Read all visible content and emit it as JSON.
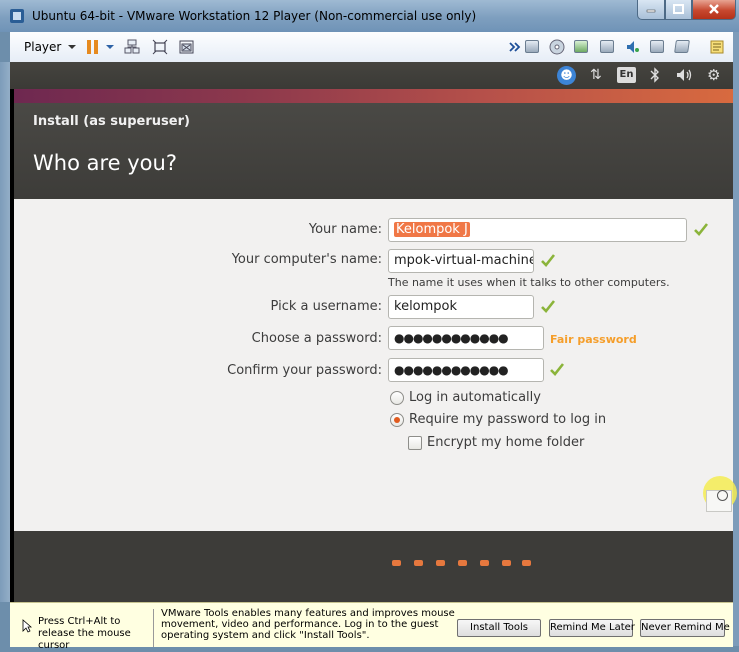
{
  "window": {
    "title": "Ubuntu 64-bit - VMware Workstation 12 Player (Non-commercial use only)"
  },
  "toolbar": {
    "player_label": "Player",
    "icons": [
      "pause-icon",
      "send-ctrl-alt-del-icon",
      "fullscreen-icon",
      "unity-icon",
      "forward-arrows-icon",
      "hard-disk-icon",
      "cd-dvd-icon",
      "network-adapter-icon",
      "printer-icon",
      "sound-card-icon",
      "display-icon",
      "usb-icon",
      "messages-icon"
    ]
  },
  "top_panel": {
    "keyboard_layout": "En",
    "icons": [
      "accessibility-icon",
      "network-icon",
      "bluetooth-icon",
      "volume-icon",
      "settings-gear-icon"
    ]
  },
  "installer": {
    "window_title": "Install (as superuser)",
    "page_title": "Who are you?",
    "fields": {
      "name": {
        "label": "Your name:",
        "value": "Kelompok J"
      },
      "computer_name": {
        "label": "Your computer's name:",
        "value": "mpok-virtual-machine",
        "hint": "The name it uses when it talks to other computers."
      },
      "username": {
        "label": "Pick a username:",
        "value": "kelompok"
      },
      "password": {
        "label": "Choose a password:",
        "value": "●●●●●●●●●●●●",
        "strength": "Fair password"
      },
      "confirm_password": {
        "label": "Confirm your password:",
        "value": "●●●●●●●●●●●●"
      }
    },
    "login_options": {
      "auto_login": {
        "label": "Log in automatically",
        "selected": false
      },
      "require_password": {
        "label": "Require my password to log in",
        "selected": true
      },
      "encrypt_home": {
        "label": "Encrypt my home folder",
        "checked": false
      }
    },
    "progress": {
      "total_steps": 7
    },
    "colors": {
      "accent": "#e05a1e",
      "check": "#8bb43a",
      "strength": "#f59e2a",
      "header": "#3d3c39"
    }
  },
  "vmware_tools_bar": {
    "release_hint": "Press Ctrl+Alt to release the mouse cursor",
    "message": "VMware Tools enables many features and improves mouse movement, video and performance. Log in to the guest operating system and click \"Install Tools\".",
    "install_button": "Install Tools",
    "remind_later_button": "Remind Me Later",
    "never_remind_button": "Never Remind Me"
  }
}
